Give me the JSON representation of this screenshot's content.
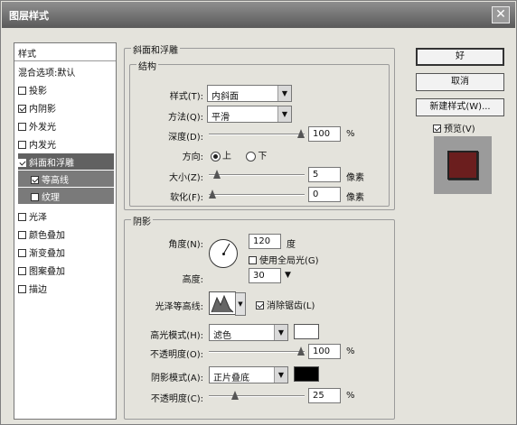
{
  "window": {
    "title": "图层样式",
    "close": "✕"
  },
  "sidebar": {
    "header": "样式",
    "items": [
      {
        "label": "混合选项:默认",
        "checked": null
      },
      {
        "label": "投影",
        "checked": false
      },
      {
        "label": "内阴影",
        "checked": true
      },
      {
        "label": "外发光",
        "checked": false
      },
      {
        "label": "内发光",
        "checked": false
      },
      {
        "label": "斜面和浮雕",
        "checked": true,
        "selected": true
      },
      {
        "label": "等高线",
        "checked": true,
        "sub": true
      },
      {
        "label": "纹理",
        "checked": false,
        "sub": true
      },
      {
        "label": "光泽",
        "checked": false
      },
      {
        "label": "颜色叠加",
        "checked": false
      },
      {
        "label": "渐变叠加",
        "checked": false
      },
      {
        "label": "图案叠加",
        "checked": false
      },
      {
        "label": "描边",
        "checked": false
      }
    ]
  },
  "main": {
    "title": "斜面和浮雕",
    "structure": {
      "title": "结构",
      "style_label": "样式(T):",
      "style_value": "内斜面",
      "technique_label": "方法(Q):",
      "technique_value": "平滑",
      "depth_label": "深度(D):",
      "depth_value": "100",
      "depth_unit": "%",
      "direction_label": "方向:",
      "direction_up": "上",
      "direction_down": "下",
      "size_label": "大小(Z):",
      "size_value": "5",
      "size_unit": "像素",
      "soften_label": "软化(F):",
      "soften_value": "0",
      "soften_unit": "像素"
    },
    "shading": {
      "title": "阴影",
      "angle_label": "角度(N):",
      "angle_value": "120",
      "angle_unit": "度",
      "global_light_label": "使用全局光(G)",
      "altitude_label": "高度:",
      "altitude_value": "30",
      "gloss_label": "光泽等高线:",
      "antialias_label": "消除锯齿(L)",
      "highlight_label": "高光模式(H):",
      "highlight_value": "滤色",
      "highlight_opacity_label": "不透明度(O):",
      "highlight_opacity_value": "100",
      "highlight_opacity_unit": "%",
      "shadow_label": "阴影模式(A):",
      "shadow_value": "正片叠底",
      "shadow_opacity_label": "不透明度(C):",
      "shadow_opacity_value": "25",
      "shadow_opacity_unit": "%"
    }
  },
  "buttons": {
    "ok": "好",
    "cancel": "取消",
    "new_style": "新建样式(W)...",
    "preview_label": "预览(V)"
  },
  "colors": {
    "highlight_swatch": "#ffffff",
    "shadow_swatch": "#000000",
    "preview_fill": "#6b1e1e"
  },
  "levels": {
    "depth": 1.0,
    "size": 0.05,
    "soften": 0.0,
    "highlight_opacity": 1.0,
    "shadow_opacity": 0.25
  }
}
